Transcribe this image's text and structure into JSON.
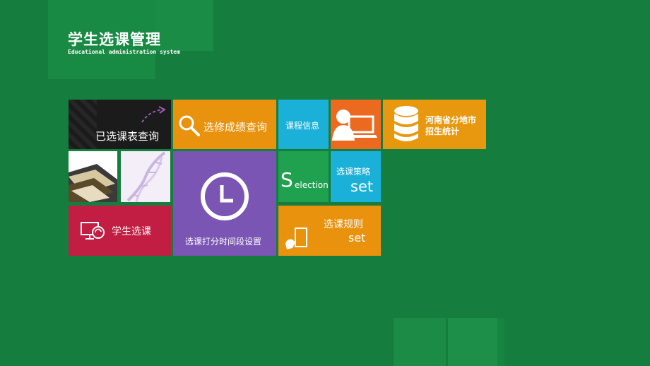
{
  "header": {
    "title": "学生选课管理",
    "subtitle": "Educational administration system"
  },
  "tiles": {
    "selected_table": {
      "label": "已选课表查询",
      "color": "#1b1b1b"
    },
    "grade_query": {
      "label": "选修成绩查询",
      "color": "#e8920d"
    },
    "course_info": {
      "label": "课程信息",
      "color": "#1ab0d8"
    },
    "user_tile": {
      "color": "#ec6a1f"
    },
    "henan_stats": {
      "label_line1": "河南省分地市",
      "label_line2": "招生统计",
      "color": "#e8980f"
    },
    "books_image": {
      "color": "#ffffff"
    },
    "dna_image": {
      "color": "#f3eef8"
    },
    "time_setting": {
      "label": "选课打分时间段设置",
      "color": "#7a55b3"
    },
    "selection": {
      "big_letter": "S",
      "rest": "election",
      "color": "#1fa14f"
    },
    "strategy_set": {
      "label": "选课策略",
      "sub": "set",
      "color": "#1ab0d8"
    },
    "student_select": {
      "label": "学生选课",
      "color": "#c21e43"
    },
    "rules_set": {
      "label": "选课规则",
      "sub": "set",
      "color": "#e8920d"
    }
  }
}
